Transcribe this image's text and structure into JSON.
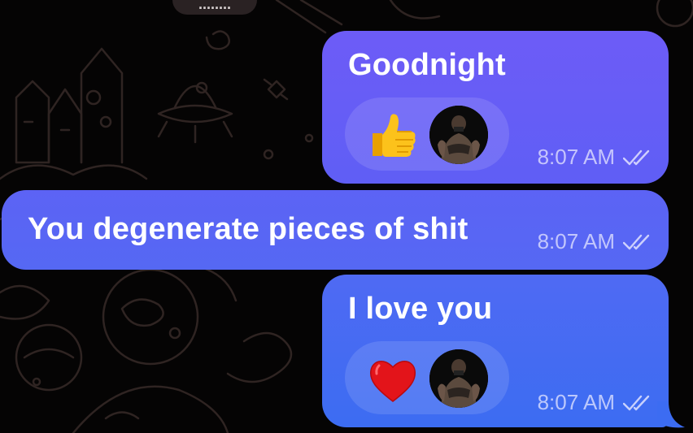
{
  "chat": {
    "top_pill": "........",
    "messages": [
      {
        "text": "Goodnight",
        "time": "8:07 AM",
        "reactions": {
          "emoji": "thumbs-up-icon",
          "count_avatars": 1
        }
      },
      {
        "text": "You degenerate pieces of shit",
        "time": "8:07 AM"
      },
      {
        "text": "I love you",
        "time": "8:07 AM",
        "reactions": {
          "emoji": "heart-icon",
          "count_avatars": 1
        }
      }
    ]
  },
  "colors": {
    "background": "#050404",
    "bubble_top": "#6d5cf7",
    "bubble_bottom": "#3c6cf2",
    "doodle": "#2e2422"
  }
}
